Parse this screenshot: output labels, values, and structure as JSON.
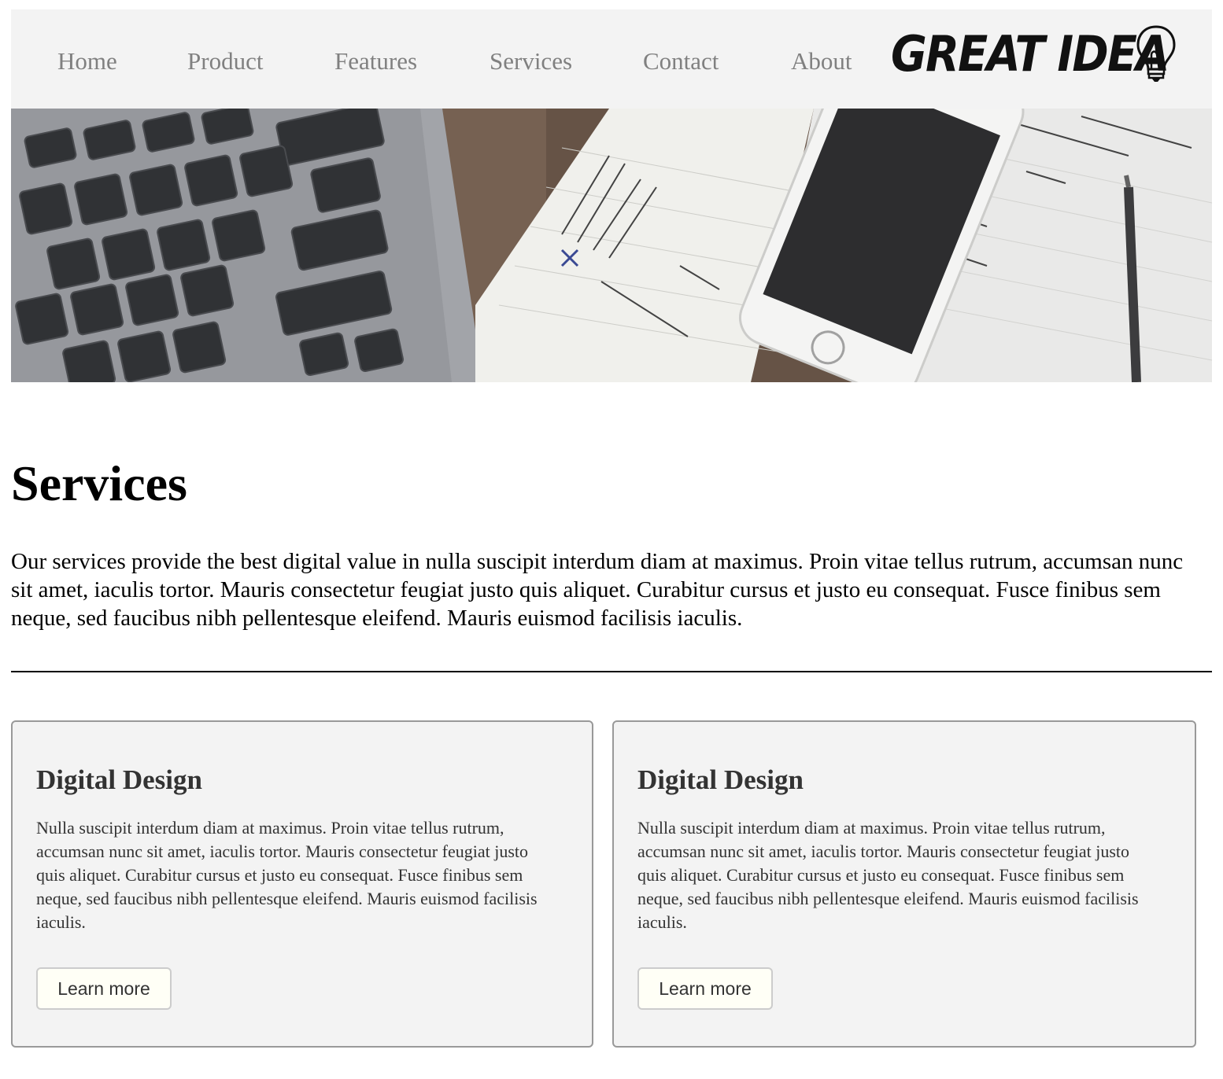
{
  "nav": {
    "items": [
      {
        "label": "Home"
      },
      {
        "label": "Product"
      },
      {
        "label": "Features"
      },
      {
        "label": "Services"
      },
      {
        "label": "Contact"
      },
      {
        "label": "About"
      }
    ],
    "logo_text": "GREAT IDEA"
  },
  "hero": {
    "image": "laptop keyboard, notebook, smartphone and pen on desk"
  },
  "main": {
    "title": "Services",
    "intro": "Our services provide the best digital value in nulla suscipit interdum diam at maximus. Proin vitae tellus rutrum, accumsan nunc sit amet, iaculis tortor. Mauris consectetur feugiat justo quis aliquet. Curabitur cursus et justo eu consequat. Fusce finibus sem neque, sed faucibus nibh pellentesque eleifend. Mauris euismod facilisis iaculis.",
    "cards": [
      {
        "title": "Digital Design",
        "text": "Nulla suscipit interdum diam at maximus. Proin vitae tellus rutrum, accumsan nunc sit amet, iaculis tortor. Mauris consectetur feugiat justo quis aliquet. Curabitur cursus et justo eu consequat. Fusce finibus sem neque, sed faucibus nibh pellentesque eleifend. Mauris euismod facilisis iaculis.",
        "button": "Learn more"
      },
      {
        "title": "Digital Design",
        "text": "Nulla suscipit interdum diam at maximus. Proin vitae tellus rutrum, accumsan nunc sit amet, iaculis tortor. Mauris consectetur feugiat justo quis aliquet. Curabitur cursus et justo eu consequat. Fusce finibus sem neque, sed faucibus nibh pellentesque eleifend. Mauris euismod facilisis iaculis.",
        "button": "Learn more"
      }
    ]
  },
  "colors": {
    "nav_bg": "#f3f3f3",
    "nav_text": "#808080",
    "card_bg": "#f3f3f3",
    "card_border": "#999999",
    "button_bg": "#fffff6"
  }
}
